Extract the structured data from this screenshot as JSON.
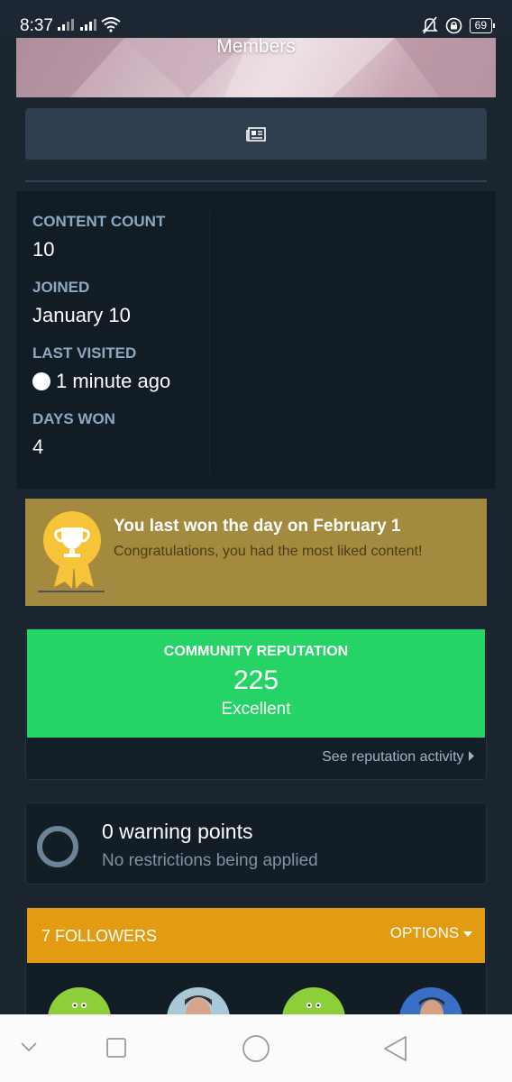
{
  "status_bar": {
    "time": "8:37",
    "battery": "69"
  },
  "cover": {
    "title": "Members"
  },
  "stats": [
    {
      "label": "CONTENT COUNT",
      "value": "10",
      "icon": null
    },
    {
      "label": "JOINED",
      "value": "January 10",
      "icon": null
    },
    {
      "label": "LAST VISITED",
      "value": "1 minute ago",
      "icon": "online-dot-icon"
    },
    {
      "label": "DAYS WON",
      "value": "4",
      "icon": null
    }
  ],
  "award": {
    "title": "You last won the day on February 1",
    "subtitle": "Congratulations, you had the most liked content!",
    "icon": "trophy-icon"
  },
  "reputation": {
    "label": "COMMUNITY REPUTATION",
    "value": "225",
    "rating": "Excellent",
    "link": "See reputation activity",
    "color": "#25d366"
  },
  "warnings": {
    "title": "0 warning points",
    "subtitle": "No restrictions being applied"
  },
  "followers": {
    "title": "7 FOLLOWERS",
    "options": "OPTIONS",
    "color": "#e39c12"
  },
  "colors": {
    "background": "#1a2530",
    "award": "#a38a3e",
    "label": "#8fa8c2"
  }
}
